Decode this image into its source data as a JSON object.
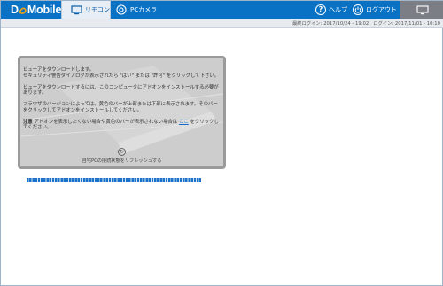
{
  "app": {
    "logo_text_1": "D",
    "logo_text_2": "Mobile"
  },
  "tabs": [
    {
      "label": "リモコン",
      "icon": "monitor-icon",
      "active": true
    },
    {
      "label": "PCカメラ",
      "icon": "camera-icon",
      "active": false
    }
  ],
  "header": {
    "help_label": "ヘルプ",
    "logout_label": "ログアウト"
  },
  "status": {
    "last_login": "最終ログイン: 2017/10/24 - 19:02",
    "login": "ログイン: 2017/11/01 - 10:10"
  },
  "panel": {
    "p1": "ビューアをダウンロードします。",
    "p2": "セキュリティ警告ダイアログが表示されたら \"はい\" または \"許可\" をクリックして下さい。",
    "p3": "ビューアをダウンロードするには、このコンピュータにアドオンをインストールする必要があります。",
    "p4": "ブラウザのバージョンによっては、黄色のバーが上部または下部に表示されます。そのバーをクリックしてアドオンをインストールしてください。",
    "note_label": "注意",
    "note_text_before": "アドオンを表示したくない場合や黄色のバーが表示されない場合は",
    "note_link": "ここ",
    "note_text_after": "をクリックしてください。",
    "refresh_label": "自宅PCの接続状態をリフレッシュする"
  },
  "progress": {
    "percent": 100
  },
  "colors": {
    "topbar": "#0a72c5",
    "progress": "#1f72c9"
  }
}
